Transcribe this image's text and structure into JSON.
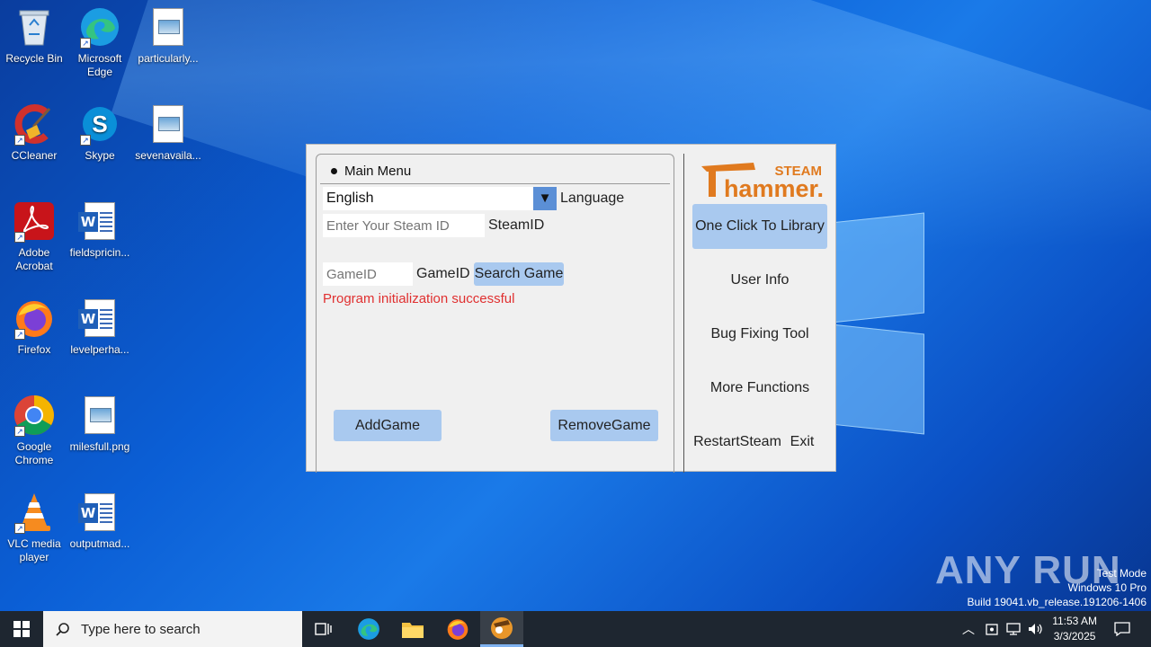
{
  "desktop": {
    "icons": [
      {
        "label": "Recycle Bin"
      },
      {
        "label": "Microsoft Edge"
      },
      {
        "label": "particularly..."
      },
      {
        "label": "CCleaner"
      },
      {
        "label": "Skype"
      },
      {
        "label": "sevenavaila..."
      },
      {
        "label": "Adobe Acrobat"
      },
      {
        "label": "fieldspricin..."
      },
      {
        "label": "Firefox"
      },
      {
        "label": "levelperha..."
      },
      {
        "label": "Google Chrome"
      },
      {
        "label": "milesfull.png"
      },
      {
        "label": "VLC media player"
      },
      {
        "label": "outputmad..."
      }
    ]
  },
  "app": {
    "panel_title": "Main Menu",
    "language_value": "English",
    "language_label": "Language",
    "steamid_placeholder": "Enter Your Steam ID",
    "steamid_label": "SteamID",
    "gameid_placeholder": "GameID",
    "gameid_label": "GameID",
    "search_game": "Search Game",
    "status": "Program initialization successful",
    "add_game": "AddGame",
    "remove_game": "RemoveGame",
    "logo_top": "STEAM",
    "logo_main": "hammer.",
    "side": {
      "one_click": "One Click To Library",
      "user_info": "User Info",
      "bug_fixing": "Bug Fixing Tool",
      "more_functions": "More Functions",
      "restart_steam": "RestartSteam",
      "exit": "Exit"
    },
    "colors": {
      "accent": "#a9c9ef",
      "status": "#e03030",
      "logo": "#e07a1f"
    }
  },
  "watermark": {
    "brand": "ANY RUN",
    "test_mode": "Test Mode",
    "edition": "Windows 10 Pro",
    "build": "Build 19041.vb_release.191206-1406"
  },
  "taskbar": {
    "search_placeholder": "Type here to search",
    "time": "11:53 AM",
    "date": "3/3/2025"
  }
}
